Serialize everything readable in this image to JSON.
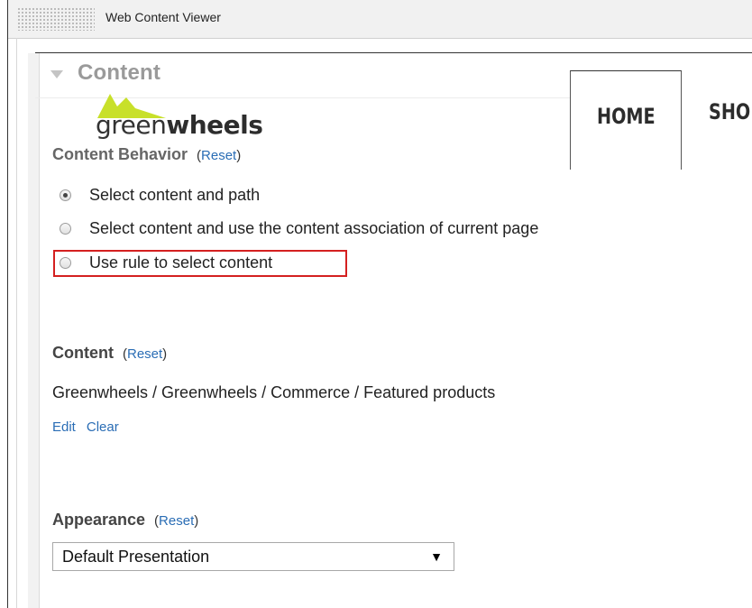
{
  "window": {
    "title": "Web Content Viewer"
  },
  "section": {
    "title": "Content"
  },
  "logo": {
    "part1": "green",
    "part2": "wheels"
  },
  "nav": {
    "tabs": [
      "HOME",
      "SHOP"
    ]
  },
  "behavior": {
    "heading": "Content Behavior",
    "reset": "Reset",
    "options": [
      {
        "label": "Select content and path",
        "checked": true
      },
      {
        "label": "Select content and use the content association of current page",
        "checked": false
      },
      {
        "label": "Use rule to select content",
        "checked": false
      }
    ]
  },
  "content": {
    "heading": "Content",
    "reset": "Reset",
    "path": "Greenwheels / Greenwheels / Commerce / Featured products",
    "edit": "Edit",
    "clear": "Clear"
  },
  "appearance": {
    "heading": "Appearance",
    "reset": "Reset",
    "selected": "Default Presentation"
  },
  "colors": {
    "highlight": "#d42020",
    "link": "#2a6db5",
    "logo_accent": "#c8e02a"
  }
}
